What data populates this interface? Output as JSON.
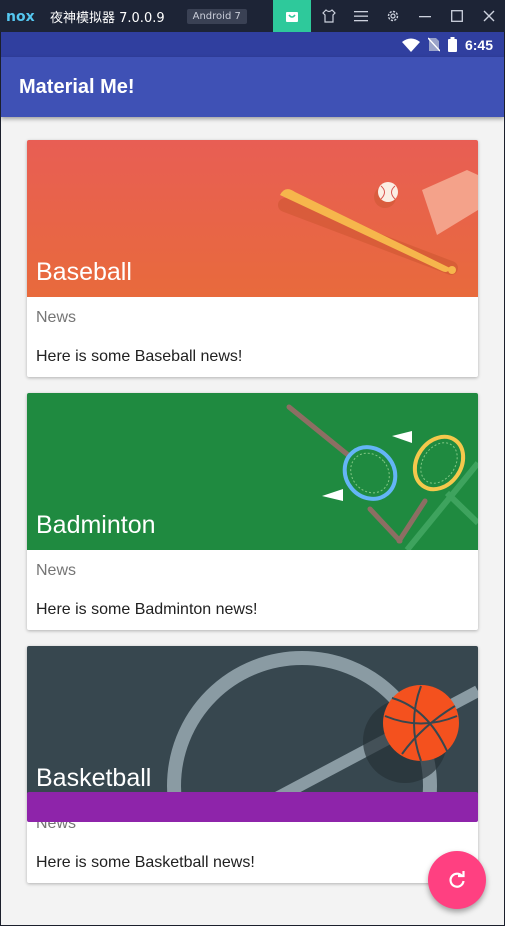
{
  "emulator": {
    "title": "夜神模拟器 7.0.0.9",
    "badge": "Android 7"
  },
  "status_bar": {
    "time": "6:45"
  },
  "app_bar": {
    "title": "Material Me!"
  },
  "cards": [
    {
      "title": "Baseball",
      "subtitle": "News",
      "info": "Here is some Baseball news!",
      "color": "#e8604a"
    },
    {
      "title": "Badminton",
      "subtitle": "News",
      "info": "Here is some Badminton news!",
      "color": "#1f8a40"
    },
    {
      "title": "Basketball",
      "subtitle": "News",
      "info": "Here is some Basketball news!",
      "color": "#37474f"
    }
  ],
  "fab": {
    "icon": "refresh-icon",
    "color": "#ff4081"
  },
  "colors": {
    "primary": "#3f51b5",
    "primary_dark": "#303f9f",
    "accent": "#ff4081"
  }
}
